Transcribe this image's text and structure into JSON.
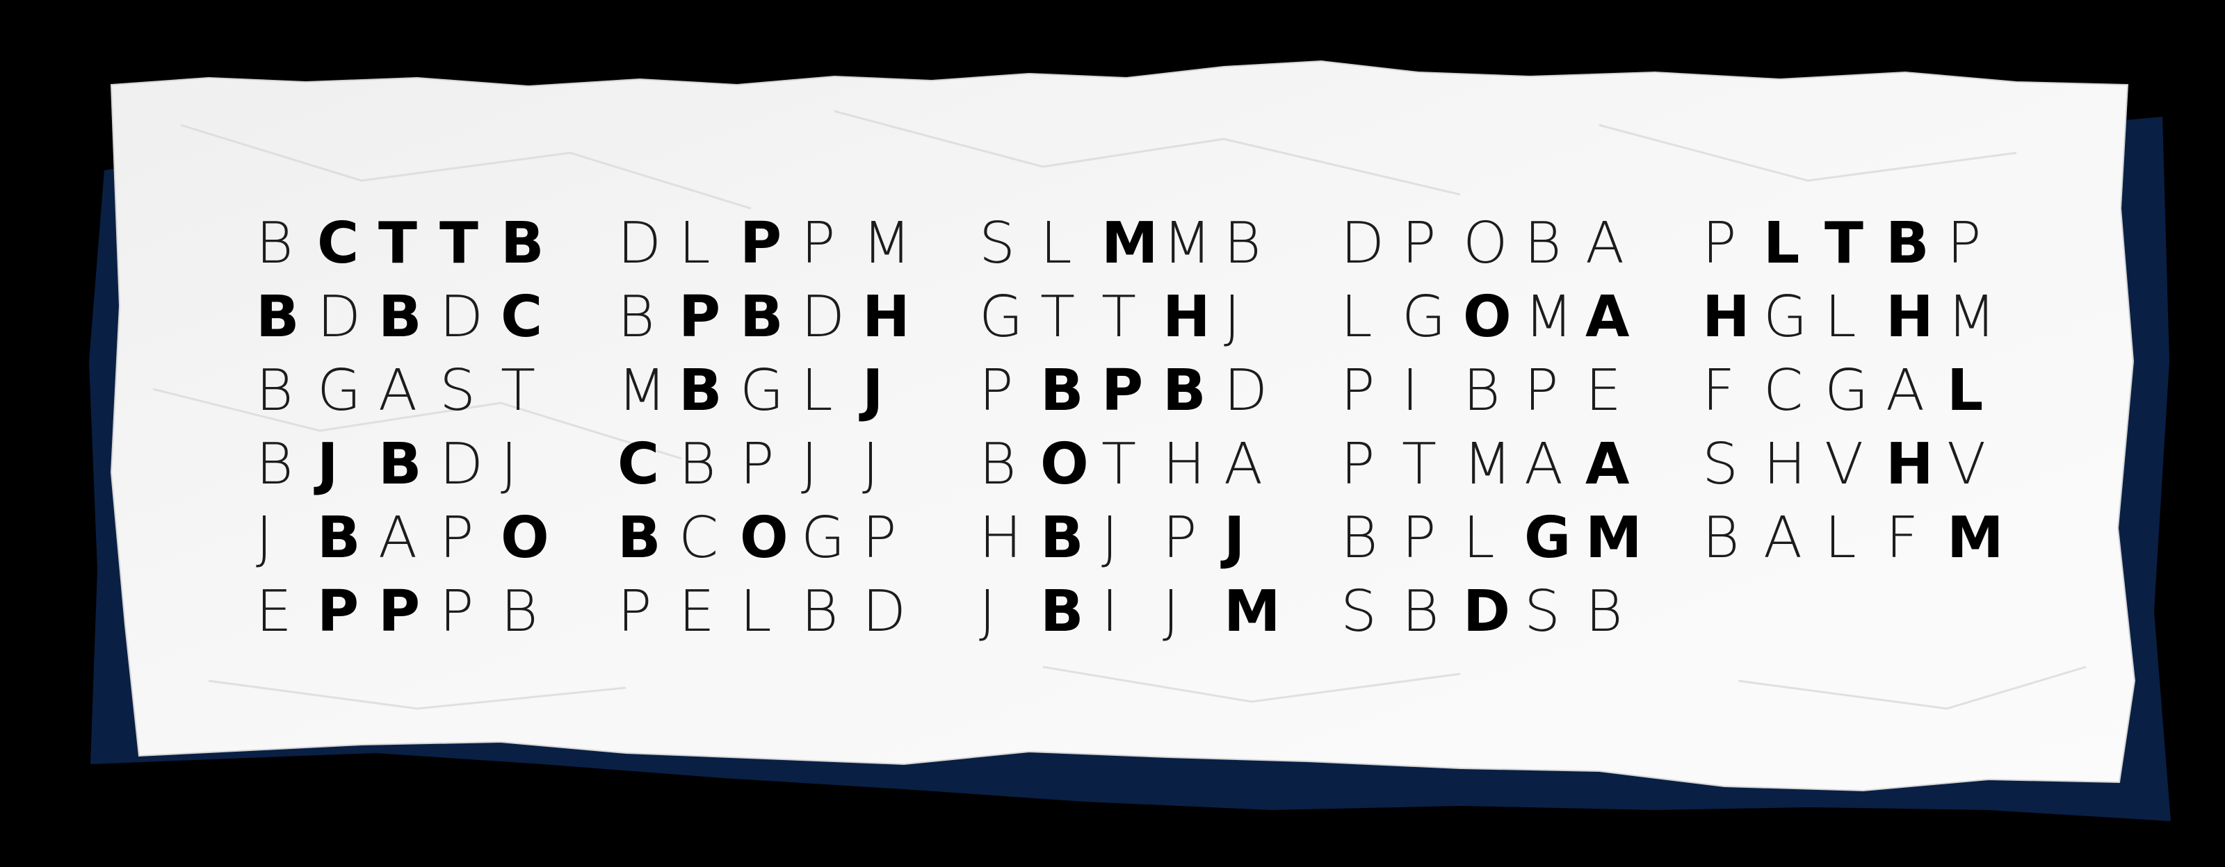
{
  "colors": {
    "background": "#000000",
    "shadow": "#0a1f44",
    "paper": "#f4f4f4",
    "ink": "#000000"
  },
  "blocks": [
    {
      "rows": [
        [
          {
            "c": "B",
            "b": false
          },
          {
            "c": "C",
            "b": true
          },
          {
            "c": "T",
            "b": true
          },
          {
            "c": "T",
            "b": true
          },
          {
            "c": "B",
            "b": true
          }
        ],
        [
          {
            "c": "B",
            "b": true
          },
          {
            "c": "D",
            "b": false
          },
          {
            "c": "B",
            "b": true
          },
          {
            "c": "D",
            "b": false
          },
          {
            "c": "C",
            "b": true
          }
        ],
        [
          {
            "c": "B",
            "b": false
          },
          {
            "c": "G",
            "b": false
          },
          {
            "c": "A",
            "b": false
          },
          {
            "c": "S",
            "b": false
          },
          {
            "c": "T",
            "b": false
          }
        ],
        [
          {
            "c": "B",
            "b": false
          },
          {
            "c": "J",
            "b": true
          },
          {
            "c": "B",
            "b": true
          },
          {
            "c": "D",
            "b": false
          },
          {
            "c": "J",
            "b": false
          }
        ],
        [
          {
            "c": "J",
            "b": false
          },
          {
            "c": "B",
            "b": true
          },
          {
            "c": "A",
            "b": false
          },
          {
            "c": "P",
            "b": false
          },
          {
            "c": "O",
            "b": true
          }
        ],
        [
          {
            "c": "E",
            "b": false
          },
          {
            "c": "P",
            "b": true
          },
          {
            "c": "P",
            "b": true
          },
          {
            "c": "P",
            "b": false
          },
          {
            "c": "B",
            "b": false
          }
        ]
      ]
    },
    {
      "rows": [
        [
          {
            "c": "D",
            "b": false
          },
          {
            "c": "L",
            "b": false
          },
          {
            "c": "P",
            "b": true
          },
          {
            "c": "P",
            "b": false
          },
          {
            "c": "M",
            "b": false
          }
        ],
        [
          {
            "c": "B",
            "b": false
          },
          {
            "c": "P",
            "b": true
          },
          {
            "c": "B",
            "b": true
          },
          {
            "c": "D",
            "b": false
          },
          {
            "c": "H",
            "b": true
          }
        ],
        [
          {
            "c": "M",
            "b": false
          },
          {
            "c": "B",
            "b": true
          },
          {
            "c": "G",
            "b": false
          },
          {
            "c": "L",
            "b": false
          },
          {
            "c": "J",
            "b": true
          }
        ],
        [
          {
            "c": "C",
            "b": true
          },
          {
            "c": "B",
            "b": false
          },
          {
            "c": "P",
            "b": false
          },
          {
            "c": "J",
            "b": false
          },
          {
            "c": "J",
            "b": false
          }
        ],
        [
          {
            "c": "B",
            "b": true
          },
          {
            "c": "C",
            "b": false
          },
          {
            "c": "O",
            "b": true
          },
          {
            "c": "G",
            "b": false
          },
          {
            "c": "P",
            "b": false
          }
        ],
        [
          {
            "c": "P",
            "b": false
          },
          {
            "c": "E",
            "b": false
          },
          {
            "c": "L",
            "b": false
          },
          {
            "c": "B",
            "b": false
          },
          {
            "c": "D",
            "b": false
          }
        ]
      ]
    },
    {
      "rows": [
        [
          {
            "c": "S",
            "b": false
          },
          {
            "c": "L",
            "b": false
          },
          {
            "c": "M",
            "b": true
          },
          {
            "c": "M",
            "b": false
          },
          {
            "c": "B",
            "b": false
          }
        ],
        [
          {
            "c": "G",
            "b": false
          },
          {
            "c": "T",
            "b": false
          },
          {
            "c": "T",
            "b": false
          },
          {
            "c": "H",
            "b": true
          },
          {
            "c": "J",
            "b": false
          }
        ],
        [
          {
            "c": "P",
            "b": false
          },
          {
            "c": "B",
            "b": true
          },
          {
            "c": "P",
            "b": true
          },
          {
            "c": "B",
            "b": true
          },
          {
            "c": "D",
            "b": false
          }
        ],
        [
          {
            "c": "B",
            "b": false
          },
          {
            "c": "O",
            "b": true
          },
          {
            "c": "T",
            "b": false
          },
          {
            "c": "H",
            "b": false
          },
          {
            "c": "A",
            "b": false
          }
        ],
        [
          {
            "c": "H",
            "b": false
          },
          {
            "c": "B",
            "b": true
          },
          {
            "c": "J",
            "b": false
          },
          {
            "c": "P",
            "b": false
          },
          {
            "c": "J",
            "b": true
          }
        ],
        [
          {
            "c": "J",
            "b": false
          },
          {
            "c": "B",
            "b": true
          },
          {
            "c": "I",
            "b": false
          },
          {
            "c": "J",
            "b": false
          },
          {
            "c": "M",
            "b": true
          }
        ]
      ]
    },
    {
      "rows": [
        [
          {
            "c": "D",
            "b": false
          },
          {
            "c": "P",
            "b": false
          },
          {
            "c": "O",
            "b": false
          },
          {
            "c": "B",
            "b": false
          },
          {
            "c": "A",
            "b": false
          }
        ],
        [
          {
            "c": "L",
            "b": false
          },
          {
            "c": "G",
            "b": false
          },
          {
            "c": "O",
            "b": true
          },
          {
            "c": "M",
            "b": false
          },
          {
            "c": "A",
            "b": true
          }
        ],
        [
          {
            "c": "P",
            "b": false
          },
          {
            "c": "I",
            "b": false
          },
          {
            "c": "B",
            "b": false
          },
          {
            "c": "P",
            "b": false
          },
          {
            "c": "E",
            "b": false
          }
        ],
        [
          {
            "c": "P",
            "b": false
          },
          {
            "c": "T",
            "b": false
          },
          {
            "c": "M",
            "b": false
          },
          {
            "c": "A",
            "b": false
          },
          {
            "c": "A",
            "b": true
          }
        ],
        [
          {
            "c": "B",
            "b": false
          },
          {
            "c": "P",
            "b": false
          },
          {
            "c": "L",
            "b": false
          },
          {
            "c": "G",
            "b": true
          },
          {
            "c": "M",
            "b": true
          }
        ],
        [
          {
            "c": "S",
            "b": false
          },
          {
            "c": "B",
            "b": false
          },
          {
            "c": "D",
            "b": true
          },
          {
            "c": "S",
            "b": false
          },
          {
            "c": "B",
            "b": false
          }
        ]
      ]
    },
    {
      "rows": [
        [
          {
            "c": "P",
            "b": false
          },
          {
            "c": "L",
            "b": true
          },
          {
            "c": "T",
            "b": true
          },
          {
            "c": "B",
            "b": true
          },
          {
            "c": "P",
            "b": false
          }
        ],
        [
          {
            "c": "H",
            "b": true
          },
          {
            "c": "G",
            "b": false
          },
          {
            "c": "L",
            "b": false
          },
          {
            "c": "H",
            "b": true
          },
          {
            "c": "M",
            "b": false
          }
        ],
        [
          {
            "c": "F",
            "b": false
          },
          {
            "c": "C",
            "b": false
          },
          {
            "c": "G",
            "b": false
          },
          {
            "c": "A",
            "b": false
          },
          {
            "c": "L",
            "b": true
          }
        ],
        [
          {
            "c": "S",
            "b": false
          },
          {
            "c": "H",
            "b": false
          },
          {
            "c": "V",
            "b": false
          },
          {
            "c": "H",
            "b": true
          },
          {
            "c": "V",
            "b": false
          }
        ],
        [
          {
            "c": "B",
            "b": false
          },
          {
            "c": "A",
            "b": false
          },
          {
            "c": "L",
            "b": false
          },
          {
            "c": "F",
            "b": false
          },
          {
            "c": "M",
            "b": true
          }
        ]
      ]
    }
  ]
}
